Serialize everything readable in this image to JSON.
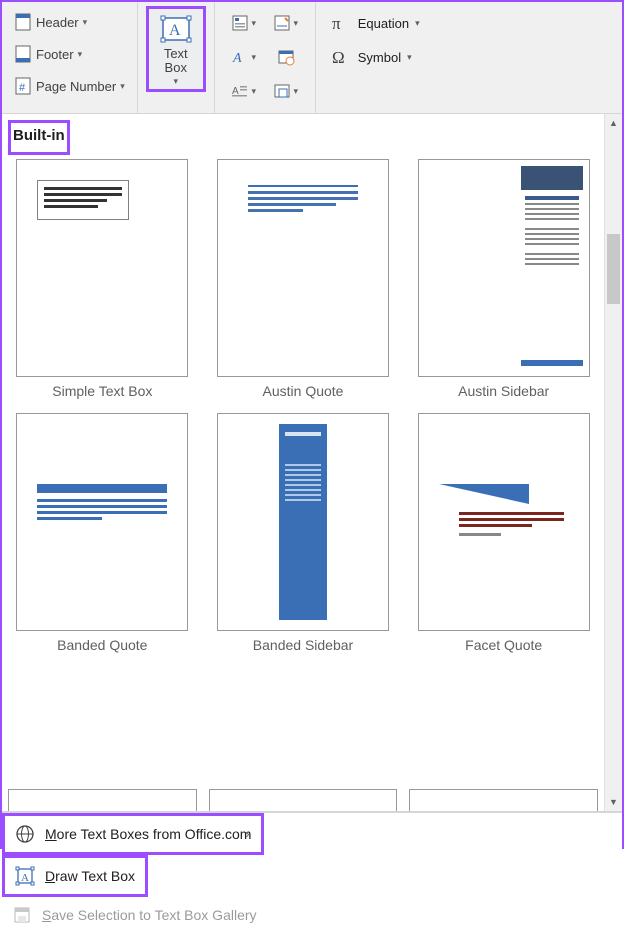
{
  "ribbon": {
    "header": "Header",
    "footer": "Footer",
    "page_number": "Page Number",
    "text_box": "Text\nBox",
    "equation": "Equation",
    "symbol": "Symbol"
  },
  "gallery": {
    "section_title": "Built-in",
    "items": [
      {
        "label": "Simple Text Box",
        "kind": "simple"
      },
      {
        "label": "Austin Quote",
        "kind": "austin_q"
      },
      {
        "label": "Austin Sidebar",
        "kind": "austin_sb"
      },
      {
        "label": "Banded Quote",
        "kind": "banded_q"
      },
      {
        "label": "Banded Sidebar",
        "kind": "banded_sb"
      },
      {
        "label": "Facet Quote",
        "kind": "facet_q"
      }
    ]
  },
  "menu": {
    "more": "More Text Boxes from Office.com",
    "draw": "Draw Text Box",
    "save": "Save Selection to Text Box Gallery"
  },
  "colors": {
    "highlight": "#9b4dff",
    "blue": "#3b6fb5"
  }
}
